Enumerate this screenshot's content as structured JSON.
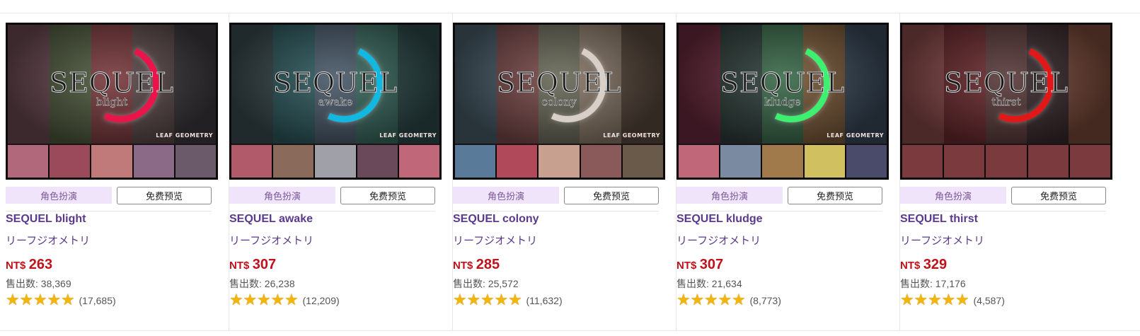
{
  "products": [
    {
      "logo_text": "SEQUEL",
      "logo_sub": "blight",
      "maker_mark": "LEAF GEOMETRY",
      "ring_color": "#e8144a",
      "panels": [
        "#6b4a52",
        "#4e5a3e",
        "#7a3a3e",
        "#5c4a4a",
        "#3e3a3e"
      ],
      "minis": [
        "#b0687a",
        "#9a4a5a",
        "#c07a7a",
        "#8a6a86",
        "#6a5a6a"
      ],
      "tag": "角色扮演",
      "preview": "免费预览",
      "title": "SEQUEL blight",
      "maker": "リーフジオメトリ",
      "currency": "NT$",
      "price": "263",
      "sales_label": "售出数: ",
      "sales": "38,369",
      "rating": 5,
      "reviews": "(17,685)"
    },
    {
      "logo_text": "SEQUEL",
      "logo_sub": "awake",
      "maker_mark": "LEAF GEOMETRY",
      "ring_color": "#12b8e0",
      "panels": [
        "#3a4a4e",
        "#2e5a5e",
        "#4a5a6a",
        "#3a6a5e",
        "#2e4a4a"
      ],
      "minis": [
        "#b05a6a",
        "#8a6a5a",
        "#a0a0a8",
        "#6a4a5a",
        "#c0687a"
      ],
      "tag": "角色扮演",
      "preview": "免费预览",
      "title": "SEQUEL awake",
      "maker": "リーフジオメトリ",
      "currency": "NT$",
      "price": "307",
      "sales_label": "售出数: ",
      "sales": "26,238",
      "rating": 5,
      "reviews": "(12,209)"
    },
    {
      "logo_text": "SEQUEL",
      "logo_sub": "colony",
      "maker_mark": "LEAF GEOMETRY",
      "ring_color": "#d8d0c8",
      "panels": [
        "#4a5e6a",
        "#7a4a4a",
        "#6a6a5a",
        "#8a7a6a",
        "#5a4a3e"
      ],
      "minis": [
        "#5a7a9a",
        "#b04a5a",
        "#c8a090",
        "#8a5a5a",
        "#6a5a4a"
      ],
      "tag": "角色扮演",
      "preview": "免费预览",
      "title": "SEQUEL colony",
      "maker": "リーフジオメトリ",
      "currency": "NT$",
      "price": "285",
      "sales_label": "售出数: ",
      "sales": "25,572",
      "rating": 5,
      "reviews": "(11,632)"
    },
    {
      "logo_text": "SEQUEL",
      "logo_sub": "kludge",
      "maker_mark": "LEAF GEOMETRY",
      "ring_color": "#3ef070",
      "panels": [
        "#6a2a3e",
        "#2e3e3a",
        "#3a6a4a",
        "#7a5a3a",
        "#3a4a5a"
      ],
      "minis": [
        "#c0687a",
        "#7a8aa0",
        "#a07a4a",
        "#d0c060",
        "#4a4a6a"
      ],
      "tag": "角色扮演",
      "preview": "免费预览",
      "title": "SEQUEL kludge",
      "maker": "リーフジオメトリ",
      "currency": "NT$",
      "price": "307",
      "sales_label": "售出数: ",
      "sales": "21,634",
      "rating": 5,
      "reviews": "(8,773)"
    },
    {
      "logo_text": "SEQUEL",
      "logo_sub": "thirst",
      "maker_mark": "",
      "ring_color": "#e01818",
      "panels": [
        "#8a4a4a",
        "#6a2a2e",
        "#5a3a3a",
        "#3a2a2e",
        "#7a4a3a"
      ],
      "minis": [
        "#7a3a3e",
        "#7a3a3e",
        "#7a3a3e",
        "#7a3a3e",
        "#7a3a3e"
      ],
      "tag": "角色扮演",
      "preview": "免费预览",
      "title": "SEQUEL thirst",
      "maker": "リーフジオメトリ",
      "currency": "NT$",
      "price": "329",
      "sales_label": "售出数: ",
      "sales": "17,176",
      "rating": 5,
      "reviews": "(4,587)"
    }
  ]
}
